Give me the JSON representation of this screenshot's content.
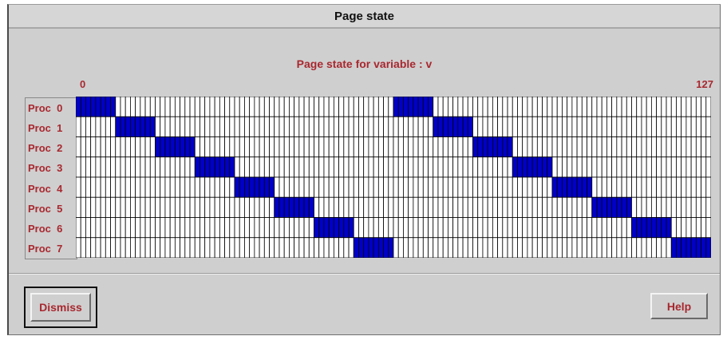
{
  "window": {
    "title": "Page state"
  },
  "heading": "Page state for variable : v",
  "axis": {
    "start_label": "0",
    "end_label": "127"
  },
  "rows": [
    "Proc  0",
    "Proc  1",
    "Proc  2",
    "Proc  3",
    "Proc  4",
    "Proc  5",
    "Proc  6",
    "Proc  7"
  ],
  "grid": {
    "pages": 128,
    "block_size": 8,
    "highlight_color": "#0000c8",
    "empty_color": "#ffffff",
    "line_color": "#000000"
  },
  "buttons": {
    "dismiss": "Dismiss",
    "help": "Help"
  }
}
